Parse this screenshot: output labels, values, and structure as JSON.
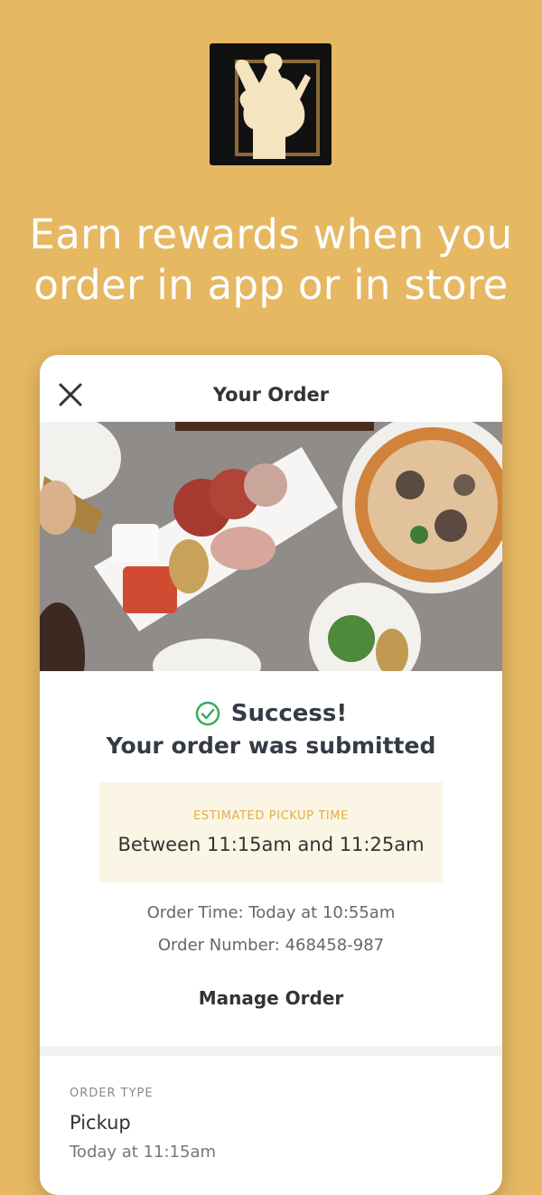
{
  "promo": {
    "headline_line1": "Earn rewards when you",
    "headline_line2": "order in app or in store"
  },
  "card": {
    "title": "Your Order",
    "success_title": "Success!",
    "success_sub": "Your order was submitted",
    "pickup_label": "ESTIMATED PICKUP TIME",
    "pickup_value": "Between 11:15am and 11:25am",
    "order_time": "Order Time: Today at 10:55am",
    "order_number": "Order Number: 468458-987",
    "manage_label": "Manage Order",
    "order_type_label": "ORDER TYPE",
    "order_type_value": "Pickup",
    "order_type_time": "Today at 11:15am"
  },
  "icons": {
    "close": "close-icon",
    "success": "check-circle-icon",
    "logo": "chef-logo"
  },
  "colors": {
    "background": "#E6B862",
    "accent": "#E1AE4A",
    "success_green": "#3BAA56",
    "pickup_box": "#FBF5E6"
  }
}
